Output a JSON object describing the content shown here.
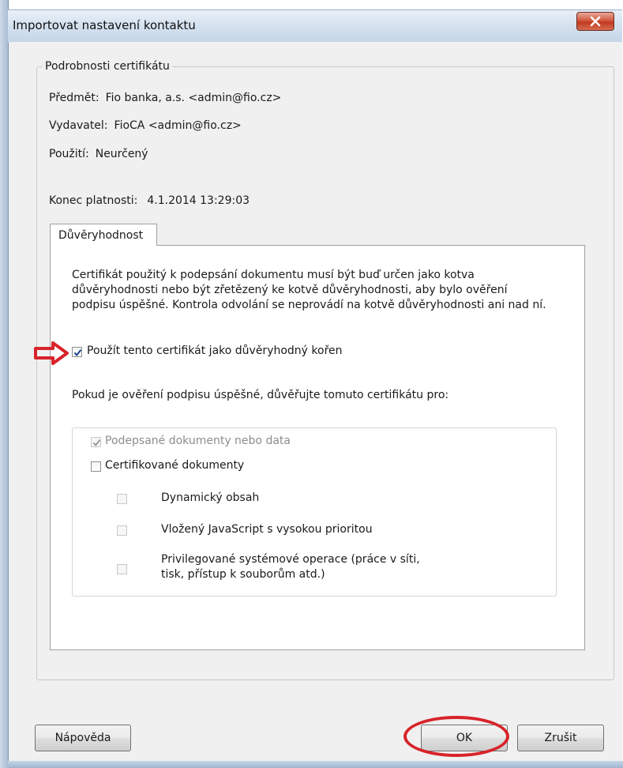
{
  "window": {
    "title": "Importovat nastavení kontaktu",
    "close_icon": "close-icon"
  },
  "certificate_details": {
    "legend": "Podrobnosti certifikátu",
    "subject_label": "Předmět:",
    "subject_value": "Fio banka, a.s. <admin@fio.cz>",
    "issuer_label": "Vydavatel:",
    "issuer_value": "FioCA <admin@fio.cz>",
    "usage_label": "Použití:",
    "usage_value": "Neurčený",
    "expiry_label": "Konec platnosti:",
    "expiry_value": "4.1.2014 13:29:03"
  },
  "trust_tab": {
    "label": "Důvěryhodnost",
    "description": "Certifikát použitý k podepsání dokumentu musí být buď určen jako kotva důvěryhodnosti nebo být zřetězený ke kotvě důvěryhodnosti, aby bylo ověření podpisu úspěšné.  Kontrola odvolání se neprovádí na kotvě důvěryhodnosti ani nad ní.",
    "root_checkbox": {
      "label": "Použít tento certifikát jako důvěryhodný kořen",
      "checked": true
    },
    "trust_for_text": "Pokud je ověření podpisu úspěšné, důvěřujte tomuto certifikátu pro:",
    "options": {
      "signed_docs": {
        "label": "Podepsané dokumenty nebo data",
        "checked": true,
        "enabled": false
      },
      "certified_docs": {
        "label": "Certifikované dokumenty",
        "checked": false,
        "enabled": true
      },
      "dynamic_content": {
        "label": "Dynamický obsah",
        "checked": false,
        "enabled": false
      },
      "javascript": {
        "label": "Vložený JavaScript s vysokou prioritou",
        "checked": false,
        "enabled": false
      },
      "privileged_ops": {
        "label": "Privilegované systémové operace (práce v síti, tisk, přístup k souborům atd.)",
        "checked": false,
        "enabled": false
      }
    }
  },
  "buttons": {
    "help": "Nápověda",
    "ok": "OK",
    "cancel": "Zrušit"
  },
  "annotations": {
    "arrow_color": "#d8232a",
    "highlight_color": "#d8232a"
  }
}
